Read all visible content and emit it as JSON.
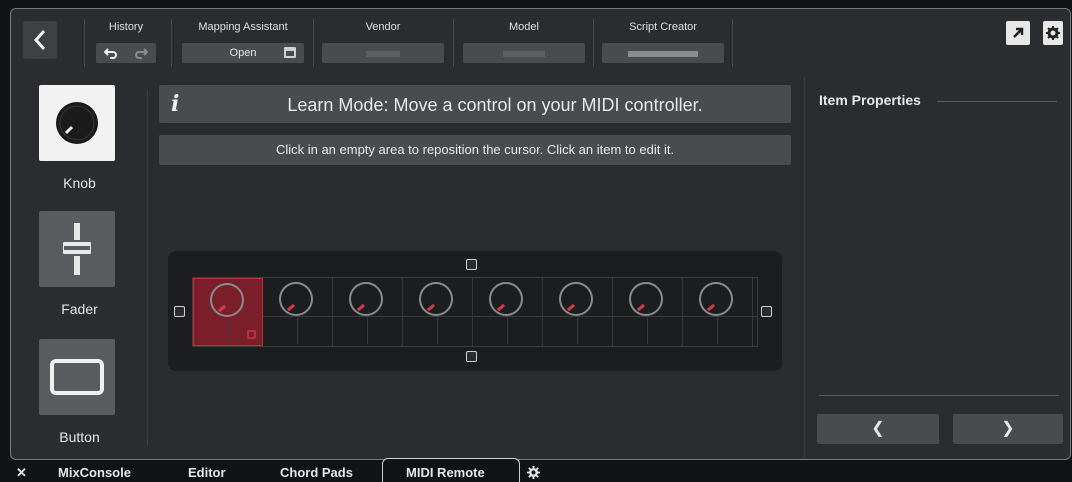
{
  "toolbar": {
    "history_label": "History",
    "mapping_label": "Mapping Assistant",
    "open_label": "Open",
    "vendor_label": "Vendor",
    "model_label": "Model",
    "script_creator_label": "Script Creator"
  },
  "banner": {
    "info_glyph": "i",
    "text": "Learn Mode: Move a control on your MIDI controller."
  },
  "hint": "Click in an empty area to reposition the cursor. Click an item to edit it.",
  "tools": [
    {
      "label": "Knob",
      "icon": "knob-icon",
      "selected": true
    },
    {
      "label": "Fader",
      "icon": "fader-icon",
      "selected": false
    },
    {
      "label": "Button",
      "icon": "button-icon",
      "selected": false
    }
  ],
  "canvas": {
    "knob_count": 8,
    "selected_index": 0
  },
  "item_properties": {
    "title": "Item Properties",
    "prev": "❮",
    "next": "❯"
  },
  "bottom_tabs": {
    "close": "✕",
    "items": [
      "MixConsole",
      "Editor",
      "Chord Pads",
      "MIDI Remote"
    ],
    "active": "MIDI Remote"
  },
  "colors": {
    "accent_red": "#b8323f",
    "selected_fill": "#7a1e2a"
  }
}
